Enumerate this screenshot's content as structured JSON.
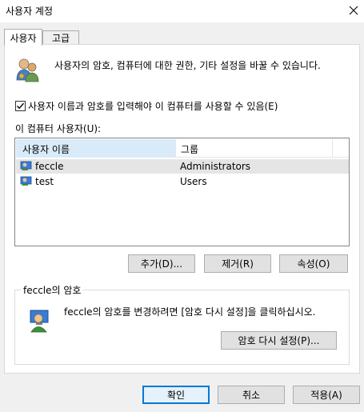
{
  "window": {
    "title": "사용자 계정",
    "close_icon": "close-icon"
  },
  "tabs": [
    {
      "label": "사용자",
      "active": true
    },
    {
      "label": "고급",
      "active": false
    }
  ],
  "intro_text": "사용자의 암호, 컴퓨터에 대한 권한, 기타 설정을 바꿀 수 있습니다.",
  "checkbox": {
    "label": "사용자 이름과 암호를 입력해야 이 컴퓨터를 사용할 수 있음(E)",
    "checked": true
  },
  "users_label": "이 컴퓨터 사용자(U):",
  "users_table": {
    "columns": [
      "사용자 이름",
      "그룹"
    ],
    "rows": [
      {
        "name": "feccle",
        "group": "Administrators",
        "selected": true
      },
      {
        "name": "test",
        "group": "Users",
        "selected": false
      }
    ]
  },
  "user_buttons": {
    "add": "추가(D)...",
    "remove": "제거(R)",
    "properties": "속성(O)"
  },
  "password_group": {
    "title": "feccle의 암호",
    "description": "feccle의 암호를 변경하려면 [암호 다시 설정]을 클릭하십시오.",
    "reset_button": "암호 다시 설정(P)..."
  },
  "dialog_buttons": {
    "ok": "확인",
    "cancel": "취소",
    "apply": "적용(A)"
  },
  "colors": {
    "accent": "#0078d7",
    "header_selected": "#d9ebf9",
    "row_selected": "#e5e5e5"
  }
}
